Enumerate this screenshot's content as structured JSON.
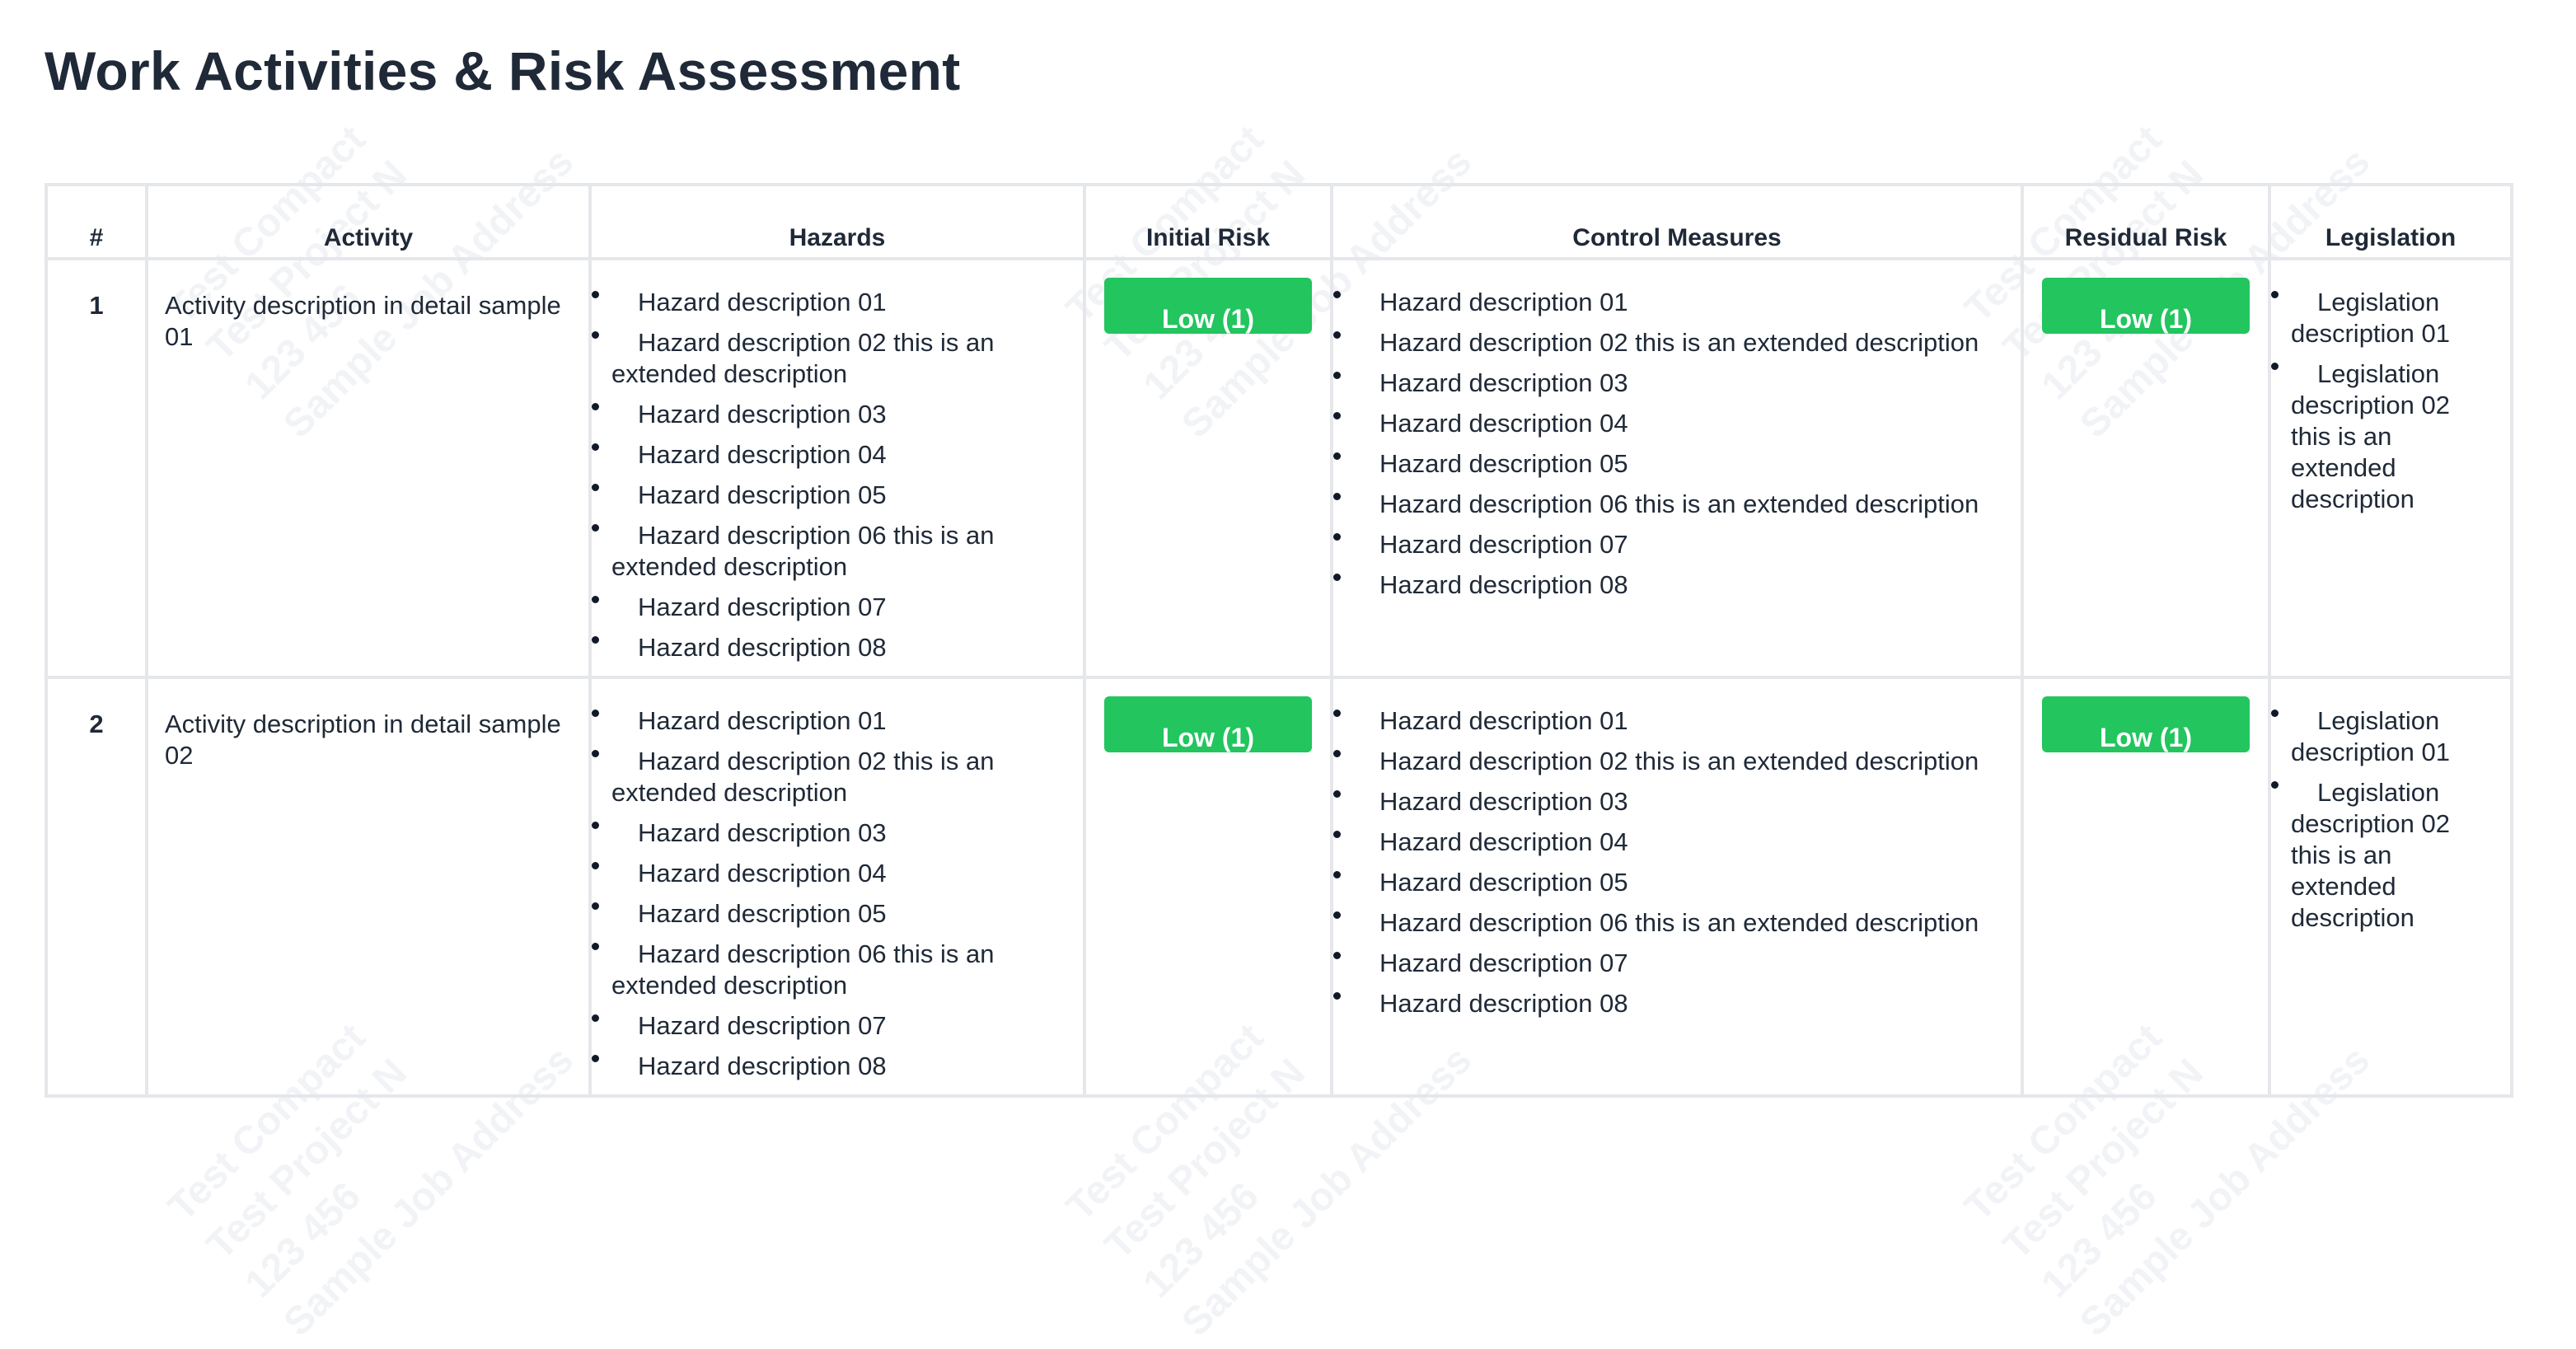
{
  "watermark": {
    "lines": [
      "Test Compact",
      "Test Project N",
      "123 456",
      "Sample Job Address"
    ]
  },
  "page": {
    "title": "Work Activities & Risk Assessment"
  },
  "table": {
    "headers": [
      "#",
      "Activity",
      "Hazards",
      "Initial Risk",
      "Control Measures",
      "Residual Risk",
      "Legislation"
    ],
    "rows": [
      {
        "num": "1",
        "activity": "Activity description in detail sample 01",
        "hazards": [
          "Hazard description 01",
          "Hazard description 02 this is an extended description",
          "Hazard description 03",
          "Hazard description 04",
          "Hazard description 05",
          "Hazard description 06 this is an extended description",
          "Hazard description 07",
          "Hazard description 08"
        ],
        "initial_risk": "Low (1)",
        "controls": [
          "Hazard description 01",
          "Hazard description 02 this is an extended description",
          "Hazard description 03",
          "Hazard description 04",
          "Hazard description 05",
          "Hazard description 06 this is an extended description",
          "Hazard description 07",
          "Hazard description 08"
        ],
        "residual_risk": "Low (1)",
        "legislation": [
          "Legislation description 01",
          "Legislation description 02 this is an extended description"
        ]
      },
      {
        "num": "2",
        "activity": "Activity description in detail sample 02",
        "hazards": [
          "Hazard description 01",
          "Hazard description 02 this is an extended description",
          "Hazard description 03",
          "Hazard description 04",
          "Hazard description 05",
          "Hazard description 06 this is an extended description",
          "Hazard description 07",
          "Hazard description 08"
        ],
        "initial_risk": "Low (1)",
        "controls": [
          "Hazard description 01",
          "Hazard description 02 this is an extended description",
          "Hazard description 03",
          "Hazard description 04",
          "Hazard description 05",
          "Hazard description 06 this is an extended description",
          "Hazard description 07",
          "Hazard description 08"
        ],
        "residual_risk": "Low (1)",
        "legislation": [
          "Legislation description 01",
          "Legislation description 02 this is an extended description"
        ]
      }
    ]
  },
  "colors": {
    "risk_low": "#22c55e",
    "grid": "#e5e7eb",
    "text": "#1f2937"
  }
}
